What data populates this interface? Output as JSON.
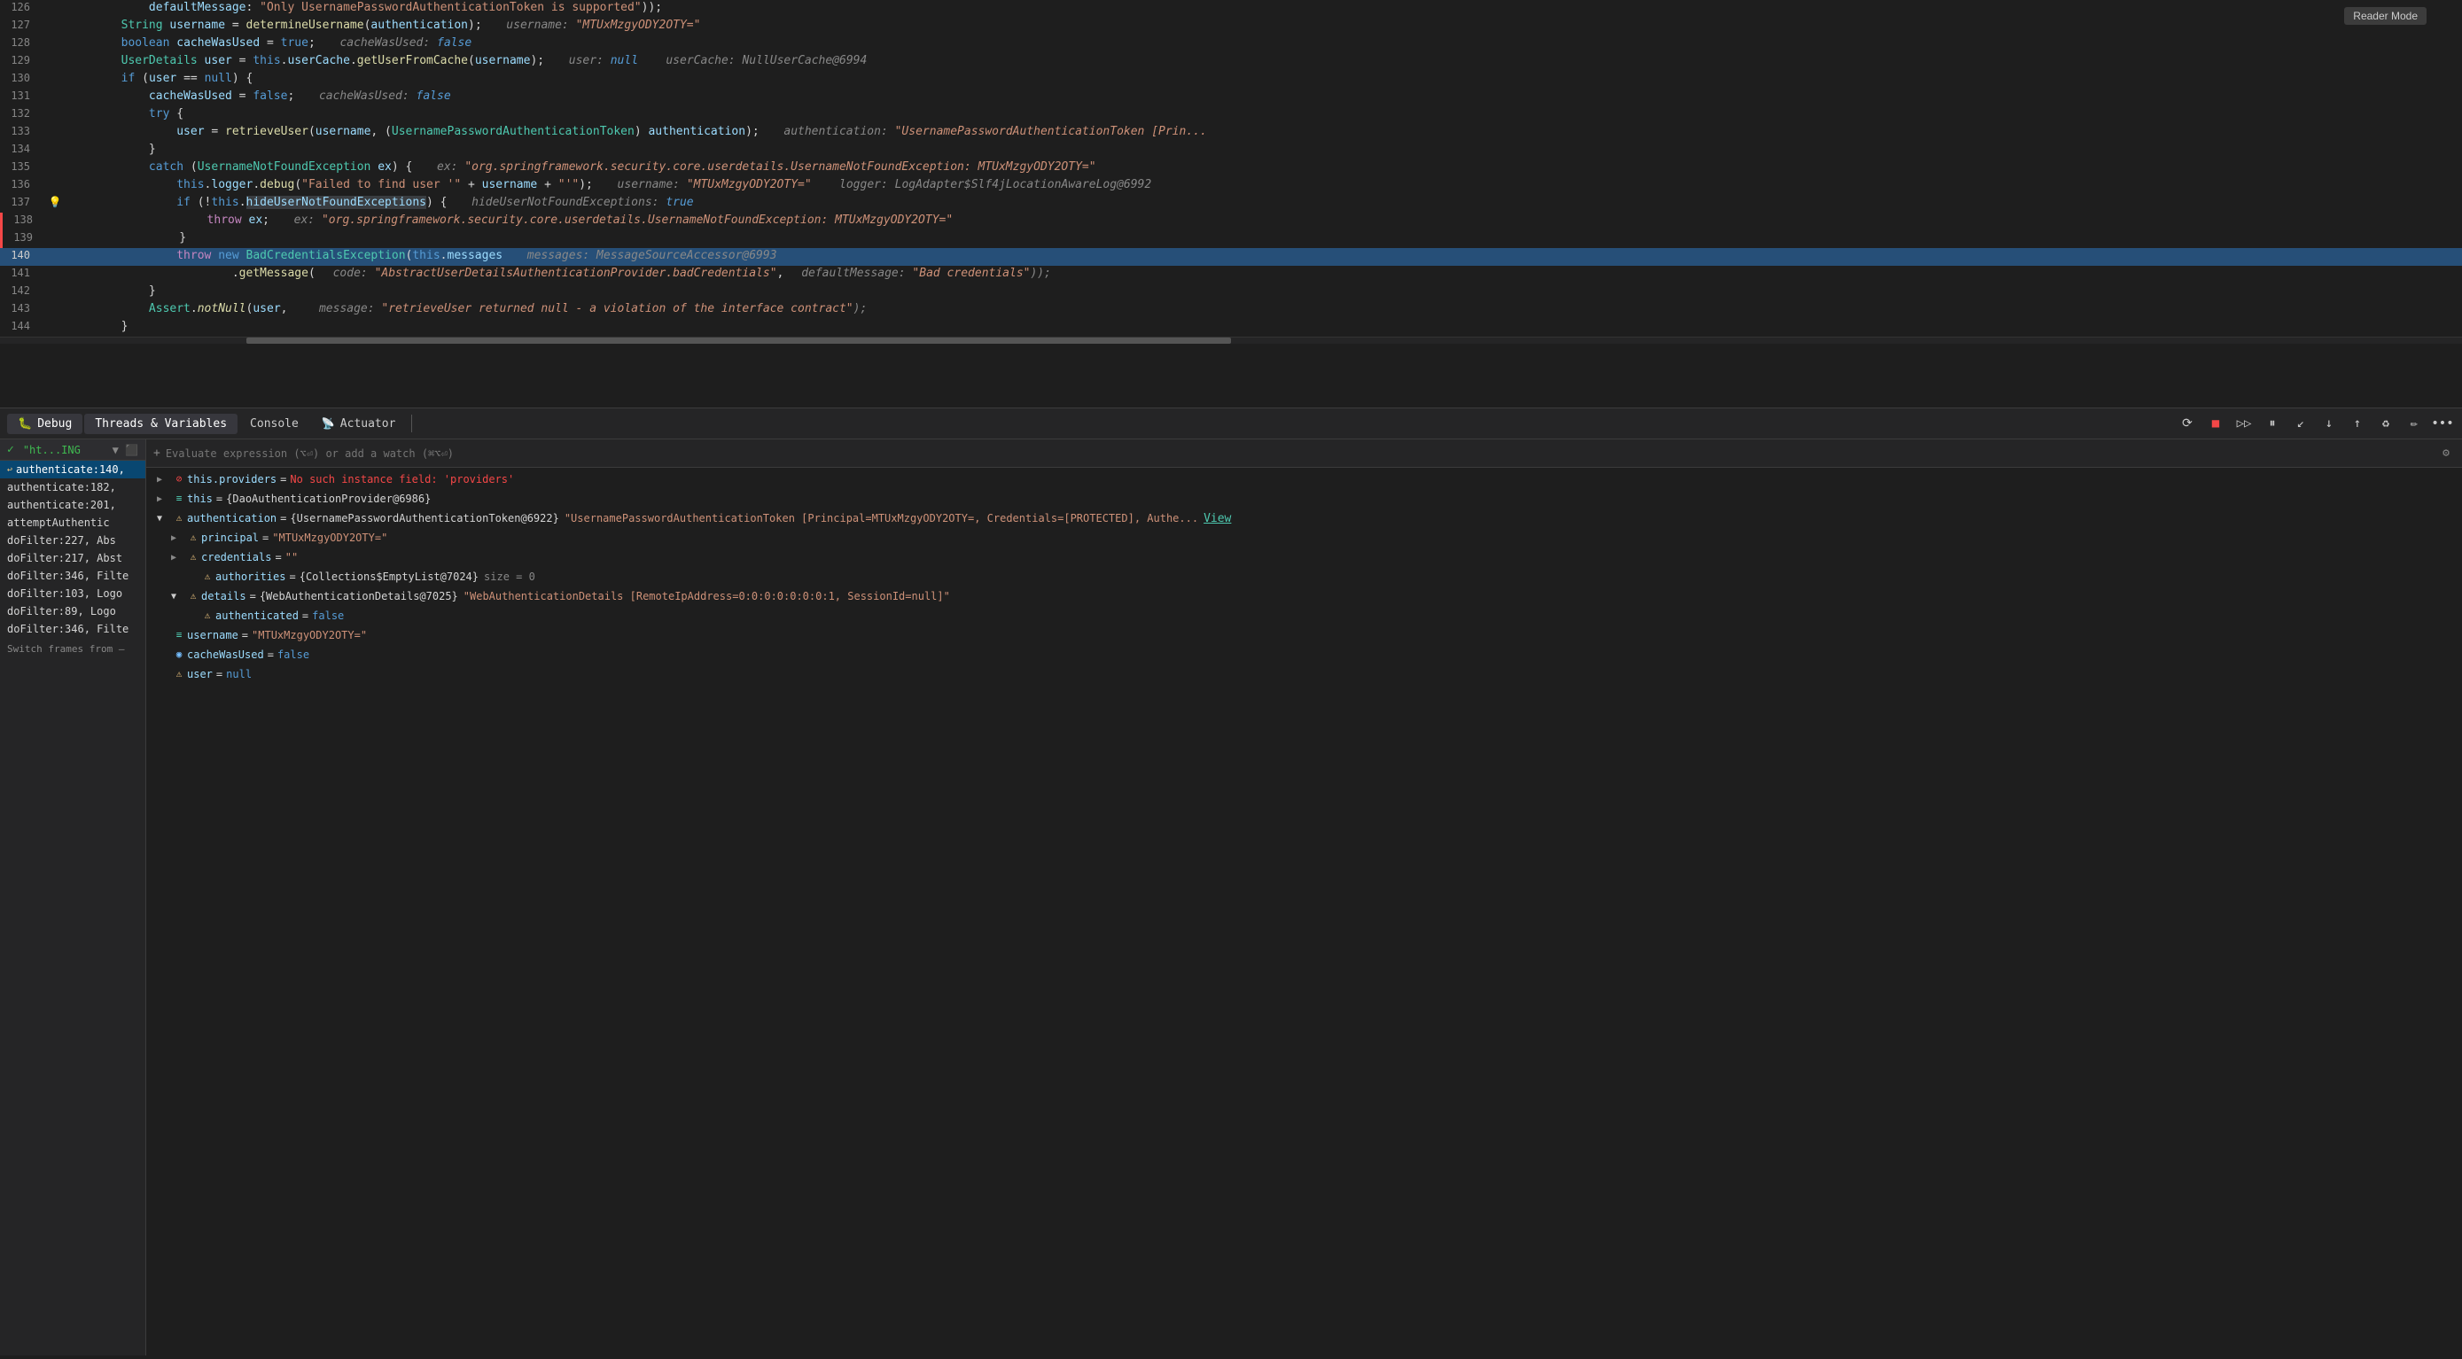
{
  "editor": {
    "reader_mode": "Reader Mode",
    "lines": [
      {
        "num": "126",
        "content": "            defaultMessage: \"Only UsernamePasswordAuthenticationToken is supported\"));",
        "highlight": false,
        "indent": 0
      },
      {
        "num": "127",
        "content": "        String username = determineUsername(authentication);",
        "debug": "username: \"MTUxMzgyODY2OTY=\"",
        "highlight": false
      },
      {
        "num": "128",
        "content": "        boolean cacheWasUsed = true;",
        "debug": "cacheWasUsed: false",
        "highlight": false
      },
      {
        "num": "129",
        "content": "        UserDetails user = this.userCache.getUserFromCache(username);",
        "debug": "user: null    userCache: NullUserCache@6994",
        "highlight": false
      },
      {
        "num": "130",
        "content": "        if (user == null) {",
        "highlight": false
      },
      {
        "num": "131",
        "content": "            cacheWasUsed = false;",
        "debug": "cacheWasUsed: false",
        "highlight": false
      },
      {
        "num": "132",
        "content": "            try {",
        "highlight": false
      },
      {
        "num": "133",
        "content": "                user = retrieveUser(username, (UsernamePasswordAuthenticationToken) authentication);",
        "debug": "authentication: \"UsernamePasswordAuthenticationToken [Prin...",
        "highlight": false
      },
      {
        "num": "134",
        "content": "            }",
        "highlight": false
      },
      {
        "num": "135",
        "content": "            catch (UsernameNotFoundException ex) {",
        "debug": "ex: \"org.springframework.security.core.userdetails.UsernameNotFoundException: MTUxMzgyODY2OTY=\"",
        "highlight": false
      },
      {
        "num": "136",
        "content": "                this.logger.debug(\"Failed to find user '\" + username + \"'\");",
        "debug": "username: \"MTUxMzgyODY2OTY=\"    logger: LogAdapter$Slf4jLocationAwareLog@6992",
        "highlight": false
      },
      {
        "num": "137",
        "content": "                if (!this.hideUserNotFoundExceptions) {",
        "debug": "hideUserNotFoundExceptions: true",
        "highlight": false,
        "bulb": true
      },
      {
        "num": "138",
        "content": "                    throw ex;",
        "debug": "ex: \"org.springframework.security.core.userdetails.UsernameNotFoundException: MTUxMzgyODY2OTY=\"",
        "highlight": false
      },
      {
        "num": "139",
        "content": "                }",
        "highlight": false
      },
      {
        "num": "140",
        "content": "                throw new BadCredentialsException(this.messages",
        "debug": "messages: MessageSourceAccessor@6993",
        "highlight": true
      },
      {
        "num": "141",
        "content": "                        .getMessage( code: \"AbstractUserDetailsAuthenticationProvider.badCredentials\",",
        "debug": "defaultMessage: \"Bad credentials\"));",
        "highlight": false
      },
      {
        "num": "142",
        "content": "            }",
        "highlight": false
      },
      {
        "num": "143",
        "content": "            Assert.notNull(user,",
        "debug": "message: \"retrieveUser returned null - a violation of the interface contract\");",
        "highlight": false
      },
      {
        "num": "144",
        "content": "        }",
        "highlight": false
      }
    ]
  },
  "debug": {
    "tabs": [
      {
        "label": "Debug",
        "icon": "🐛",
        "active": false
      },
      {
        "label": "Threads & Variables",
        "active": true
      },
      {
        "label": "Console",
        "active": false
      },
      {
        "label": "Actuator",
        "icon": "📡",
        "active": false
      }
    ],
    "toolbar_icons": [
      "⟳",
      "■",
      "▷▷",
      "⏸",
      "↙",
      "↓",
      "↑",
      "♻",
      "✏",
      "•••"
    ],
    "eval_placeholder": "Evaluate expression (⌥⏎) or add a watch (⌘⌥⏎)",
    "session": {
      "name": "\"ht...ING",
      "check": true
    },
    "frames": [
      {
        "name": "authenticate:140,",
        "active": true
      },
      {
        "name": "authenticate:182,"
      },
      {
        "name": "authenticate:201,"
      },
      {
        "name": "attemptAuthentic"
      },
      {
        "name": "doFilter:227, Abs"
      },
      {
        "name": "doFilter:217, Abst"
      },
      {
        "name": "doFilter:346, Filte"
      },
      {
        "name": "doFilter:103, Logo"
      },
      {
        "name": "doFilter:89, Logo"
      },
      {
        "name": "doFilter:346, Filte"
      }
    ],
    "switch_frames": "Switch frames from —",
    "variables": [
      {
        "id": "v1",
        "expand": false,
        "icon": "error",
        "name": "this.providers",
        "eq": "=",
        "val": "No such instance field: 'providers'",
        "val_type": "error",
        "indent": 0
      },
      {
        "id": "v2",
        "expand": true,
        "icon": "list",
        "name": "this",
        "eq": "=",
        "val": "{DaoAuthenticationProvider@6986}",
        "val_type": "obj",
        "indent": 0
      },
      {
        "id": "v3",
        "expand": true,
        "icon": "info",
        "name": "authentication",
        "eq": "=",
        "val": "{UsernamePasswordAuthenticationToken@6922}",
        "val_str": "\"UsernamePasswordAuthenticationToken [Principal=MTUxMzgyODY2OTY=, Credentials=[PROTECTED], Authe...",
        "val_type": "obj_str",
        "link": "View",
        "indent": 0
      },
      {
        "id": "v4",
        "expand": true,
        "icon": "info",
        "name": "principal",
        "eq": "=",
        "val": "\"MTUxMzgyODY2OTY=\"",
        "val_type": "str",
        "indent": 1
      },
      {
        "id": "v5",
        "expand": false,
        "icon": "info",
        "name": "credentials",
        "eq": "=",
        "val": "\"\"",
        "val_type": "str",
        "indent": 1
      },
      {
        "id": "v6",
        "expand": false,
        "icon": "info",
        "name": "authorities",
        "eq": "=",
        "val": "{Collections$EmptyList@7024}",
        "val_extra": "size = 0",
        "val_type": "obj",
        "indent": 2
      },
      {
        "id": "v7",
        "expand": true,
        "icon": "info",
        "name": "details",
        "eq": "=",
        "val": "{WebAuthenticationDetails@7025}",
        "val_str": "\"WebAuthenticationDetails [RemoteIpAddress=0:0:0:0:0:0:0:1, SessionId=null]\"",
        "val_type": "obj_str",
        "indent": 1
      },
      {
        "id": "v8",
        "expand": false,
        "icon": "info",
        "name": "authenticated",
        "eq": "=",
        "val": "false",
        "val_type": "bool",
        "indent": 2
      },
      {
        "id": "v9",
        "expand": false,
        "icon": "list",
        "name": "username",
        "eq": "=",
        "val": "\"MTUxMzgyODY2OTY=\"",
        "val_type": "str",
        "indent": 0
      },
      {
        "id": "v10",
        "expand": false,
        "icon": "blue",
        "name": "cacheWasUsed",
        "eq": "=",
        "val": "false",
        "val_type": "bool",
        "indent": 0
      },
      {
        "id": "v11",
        "expand": false,
        "icon": "info",
        "name": "user",
        "eq": "=",
        "val": "null",
        "val_type": "null",
        "indent": 0
      }
    ]
  }
}
